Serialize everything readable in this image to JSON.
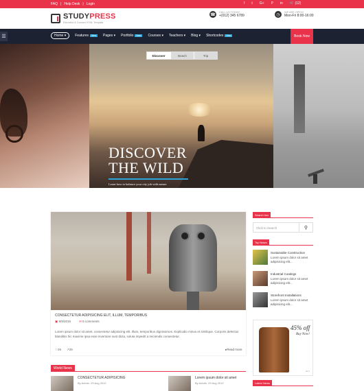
{
  "topbar": {
    "links": [
      "FAQ",
      "|",
      "Help Desk",
      "|",
      "Login"
    ],
    "social": [
      {
        "icon": "facebook-icon",
        "glyph": "f"
      },
      {
        "icon": "twitter-icon",
        "glyph": "t"
      },
      {
        "icon": "google-plus-icon",
        "glyph": "G+"
      },
      {
        "icon": "pinterest-icon",
        "glyph": "P"
      },
      {
        "icon": "linkedin-icon",
        "glyph": "in"
      },
      {
        "icon": "cart-icon",
        "glyph": "🛒 (12)"
      }
    ]
  },
  "header": {
    "logo_main": "STUDY",
    "logo_accent": "PRESS",
    "tagline": "Education & Courses HTML Template",
    "call_label": "CALL US TODAY!",
    "call_value": "+(012) 345 6789",
    "open_label": "WE ARE OPEN!",
    "open_value": "Mon-Fri 8:00-16:00"
  },
  "nav": {
    "items": [
      {
        "label": "Home ▾",
        "badge": ""
      },
      {
        "label": "Features",
        "badge": "New"
      },
      {
        "label": "Pages ▾",
        "badge": ""
      },
      {
        "label": "Portfolio",
        "badge": "New"
      },
      {
        "label": "Courses ▾",
        "badge": ""
      },
      {
        "label": "Teachers ▾",
        "badge": ""
      },
      {
        "label": "Blog ▾",
        "badge": ""
      },
      {
        "label": "Shortcodes",
        "badge": "New"
      }
    ],
    "book_now": "Book Now"
  },
  "slider": {
    "tabs": [
      "Discover",
      "Beach",
      "Trip"
    ],
    "active_tab": "Discover",
    "headline_1": "DISCOVER",
    "headline_2": "THE WILD",
    "subline": "Learn how to balance your city job with nature"
  },
  "post": {
    "title": "CONSECTETUR ADIPISICING ELIT, ILLUM, TEMPORIBUS",
    "date": "9/9/2015",
    "comments": "5 comments",
    "excerpt": "Lorem ipsum dolor sit amet, consectetur adipisicing elit. Illum, temporibus dignissimos. Explicabo minus et similique. Corporis delectus blanditiis hic maxime ipsa esse inventore sunt dicta, soluta impedit a reiciendis consectetur.",
    "likes": "26",
    "shares": "25",
    "read_more": "Read more"
  },
  "world_news": {
    "label": "World News",
    "items": [
      {
        "title": "CONSECTETUR ADIPISICING",
        "meta": "By Admin, 29 Aug 2012"
      },
      {
        "title": "Lorem ipsum dolor sit amet",
        "meta": "By Admin, 29 Aug 2012"
      }
    ]
  },
  "sidebar": {
    "search_label": "Search box",
    "search_placeholder": "Click to Search",
    "top_news_label": "Top News",
    "top_news": [
      {
        "title": "Sustainable Construction",
        "excerpt": "Lorem ipsum dolor sit amet adipisicing elit..."
      },
      {
        "title": "Industrial Coatings",
        "excerpt": "Lorem ipsum dolor sit amet adipisicing elit..."
      },
      {
        "title": "Storefront Installations",
        "excerpt": "Lorem ipsum dolor sit amet adipisicing elit..."
      }
    ],
    "ad_percent": "45% off",
    "ad_cta": "Buy Now!",
    "ad_small": "ds.h",
    "latest_news_label": "Latest News"
  },
  "colors": {
    "accent": "#e8334a",
    "nav_bg": "#1d2233",
    "badge": "#2aa6dc"
  }
}
